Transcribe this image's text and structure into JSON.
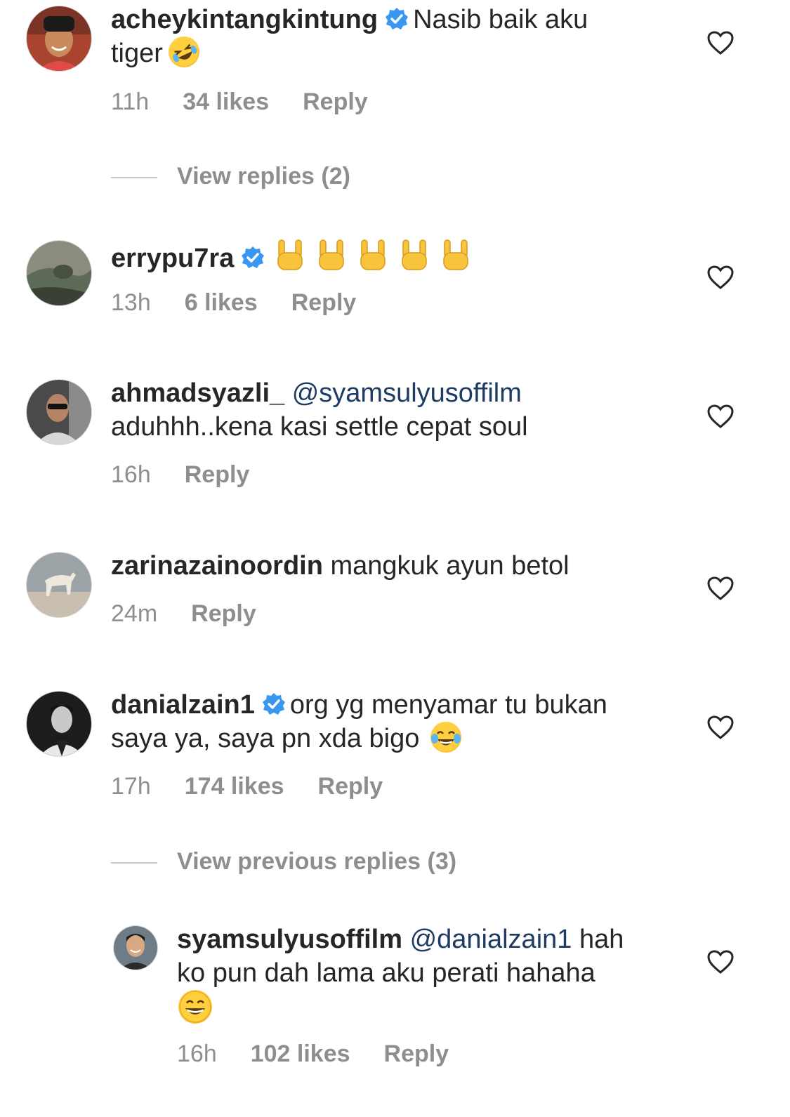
{
  "comments": [
    {
      "username": "acheykintangkintung",
      "verified": true,
      "text_line1": "Nasib baik aku",
      "text_line2": "tiger",
      "time": "11h",
      "likes": "34 likes",
      "reply": "Reply",
      "view_replies": "View replies (2)"
    },
    {
      "username": "errypu7ra",
      "verified": true,
      "time": "13h",
      "likes": "6 likes",
      "reply": "Reply"
    },
    {
      "username": "ahmadsyazli_",
      "mention": "@syamsulyusoffilm",
      "text_line2": "aduhhh..kena kasi settle cepat soul",
      "time": "16h",
      "reply": "Reply"
    },
    {
      "username": "zarinazainoordin",
      "text": "mangkuk ayun betol",
      "time": "24m",
      "reply": "Reply"
    },
    {
      "username": "danialzain1",
      "verified": true,
      "text_line1": "org yg menyamar tu bukan",
      "text_line2": "saya ya, saya pn xda bigo",
      "time": "17h",
      "likes": "174 likes",
      "reply": "Reply",
      "view_replies": "View previous replies (3)"
    },
    {
      "username": "syamsulyusoffilm",
      "mention": "@danialzain1",
      "text_line1": "hah",
      "text_line2": "ko pun dah lama aku perati hahaha",
      "time": "16h",
      "likes": "102 likes",
      "reply": "Reply"
    }
  ],
  "icons": {
    "heart": "heart-outline-icon",
    "verified": "verified-badge-icon"
  },
  "colors": {
    "text": "#262626",
    "meta": "#8e8e8e",
    "mention": "#1e3b64",
    "verified": "#3897f0"
  }
}
